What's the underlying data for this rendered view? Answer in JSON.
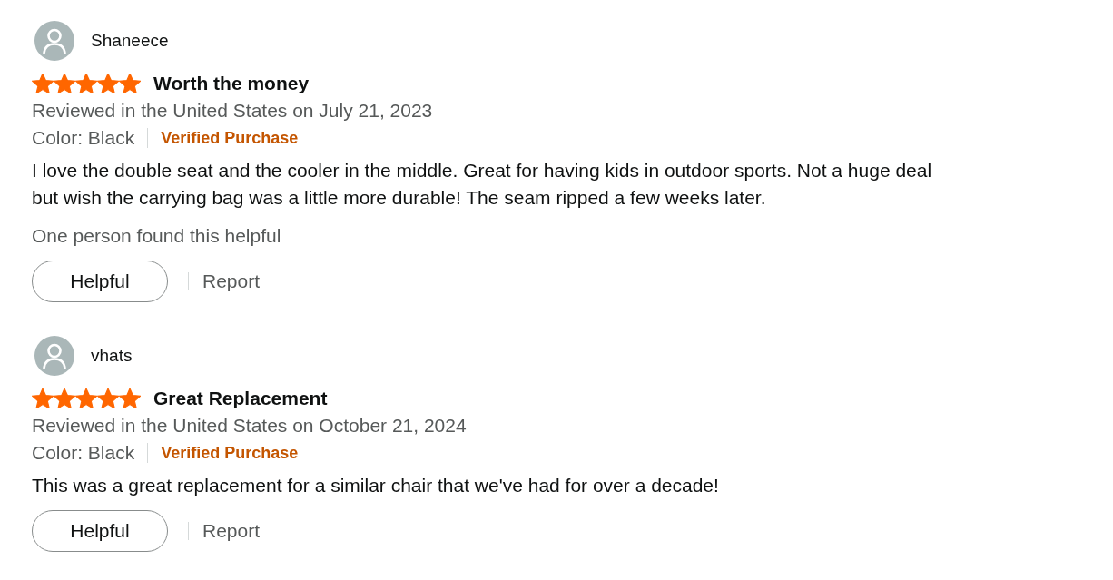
{
  "reviews": [
    {
      "reviewer": "Shaneece",
      "stars": 5,
      "title": "Worth the money",
      "date_line": "Reviewed in the United States on July 21, 2023",
      "variant": "Color: Black",
      "badge": "Verified Purchase",
      "body": "I love the double seat and the cooler in the middle. Great for having kids in outdoor sports. Not a huge deal but wish the carrying bag was a little more durable! The seam ripped a few weeks later.",
      "helpful_count": "One person found this helpful",
      "helpful_button": "Helpful",
      "report_link": "Report"
    },
    {
      "reviewer": "vhats",
      "stars": 5,
      "title": "Great Replacement",
      "date_line": "Reviewed in the United States on October 21, 2024",
      "variant": "Color: Black",
      "badge": "Verified Purchase",
      "body": "This was a great replacement for a similar chair that we've had for over a decade!",
      "helpful_button": "Helpful",
      "report_link": "Report"
    }
  ]
}
